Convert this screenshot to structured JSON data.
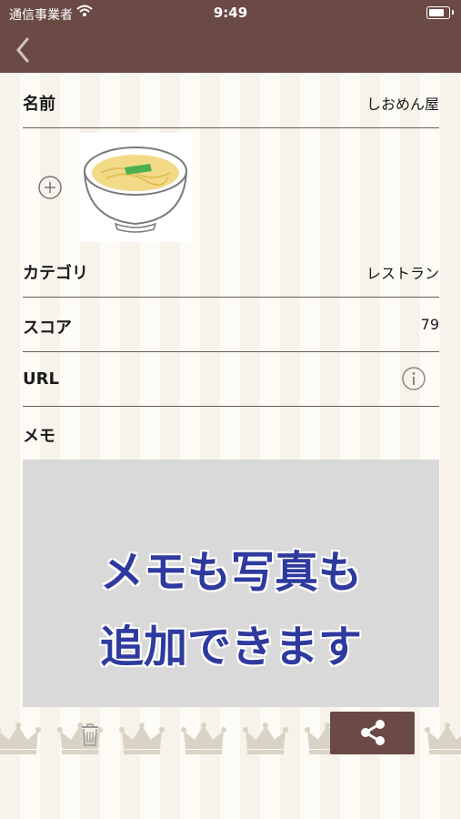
{
  "status_bar": {
    "carrier": "通信事業者",
    "time": "9:49"
  },
  "fields": {
    "name": {
      "label": "名前",
      "value": "しおめん屋"
    },
    "category": {
      "label": "カテゴリ",
      "value": "レストラン"
    },
    "score": {
      "label": "スコア",
      "value": "79"
    },
    "url": {
      "label": "URL",
      "value": ""
    },
    "memo": {
      "label": "メモ"
    }
  },
  "promo": {
    "line1": "メモも写真も",
    "line2": "追加できます"
  },
  "icons": [
    "back-chevron-icon",
    "plus-circle-icon",
    "info-icon",
    "trash-icon",
    "share-icon",
    "crown-icon",
    "wifi-icon",
    "battery-icon"
  ],
  "colors": {
    "brand_brown": "#6b4a45",
    "promo_blue": "#2e3a9e",
    "memo_bg": "#d9d9d9"
  }
}
